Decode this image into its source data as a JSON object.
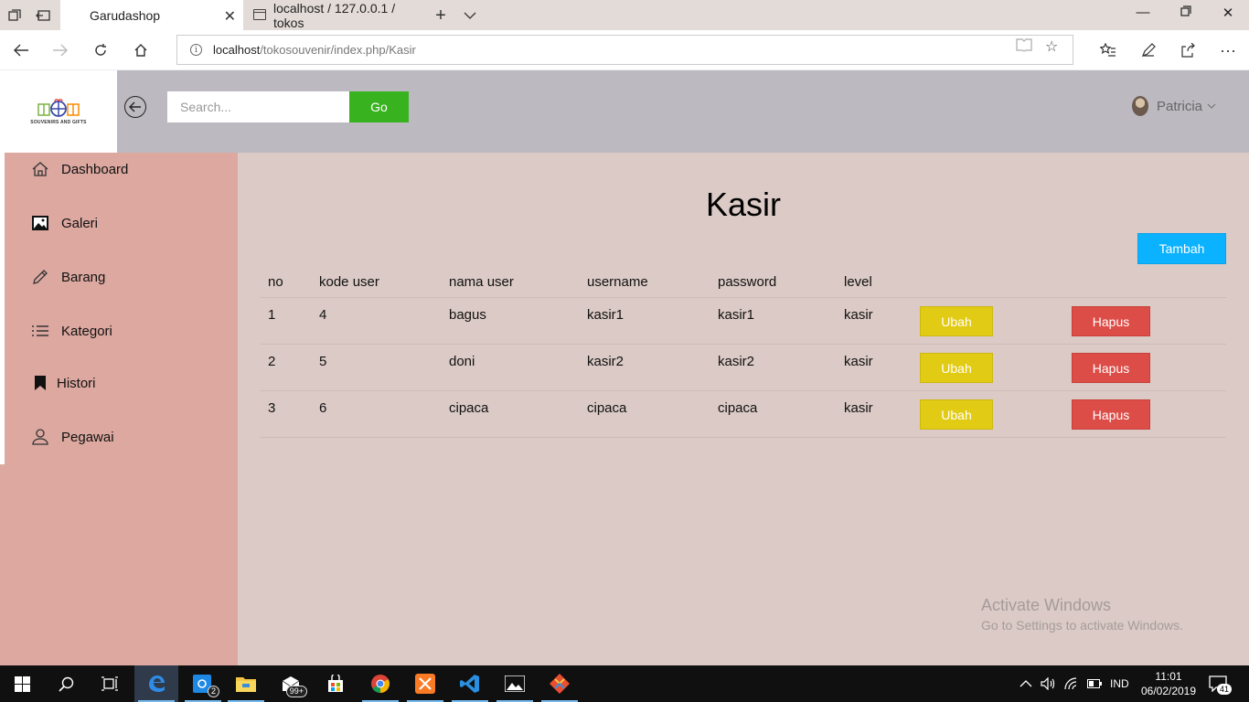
{
  "browser": {
    "tabs": [
      {
        "label": "Garudashop",
        "active": true
      },
      {
        "label": "localhost / 127.0.0.1 / tokos",
        "active": false
      }
    ],
    "address": {
      "host": "localhost",
      "path": "/tokosouvenir/index.php/Kasir"
    }
  },
  "header": {
    "logo_caption": "SOUVENIRS AND GIFTS",
    "search": {
      "placeholder": "Search...",
      "value": ""
    },
    "go_label": "Go",
    "user_name": "Patricia"
  },
  "sidebar": {
    "items": [
      {
        "label": "Dashboard",
        "icon": "home-icon"
      },
      {
        "label": "Galeri",
        "icon": "image-icon"
      },
      {
        "label": "Barang",
        "icon": "pencil-icon"
      },
      {
        "label": "Kategori",
        "icon": "list-icon"
      },
      {
        "label": "Histori",
        "icon": "bookmark-icon"
      },
      {
        "label": "Pegawai",
        "icon": "user-icon"
      }
    ]
  },
  "main": {
    "title": "Kasir",
    "add_label": "Tambah",
    "columns": [
      "no",
      "kode user",
      "nama user",
      "username",
      "password",
      "level"
    ],
    "rows": [
      {
        "no": "1",
        "kode_user": "4",
        "nama_user": "bagus",
        "username": "kasir1",
        "password": "kasir1",
        "level": "kasir"
      },
      {
        "no": "2",
        "kode_user": "5",
        "nama_user": "doni",
        "username": "kasir2",
        "password": "kasir2",
        "level": "kasir"
      },
      {
        "no": "3",
        "kode_user": "6",
        "nama_user": "cipaca",
        "username": "cipaca",
        "password": "cipaca",
        "level": "kasir"
      }
    ],
    "edit_label": "Ubah",
    "delete_label": "Hapus"
  },
  "watermark": {
    "line1": "Activate Windows",
    "line2": "Go to Settings to activate Windows."
  },
  "taskbar": {
    "mail_badge": "2",
    "store_badge": "99+",
    "language": "IND",
    "time": "11:01",
    "date": "06/02/2019",
    "notification_count": "41"
  },
  "colors": {
    "header_bg": "#bcb9c0",
    "sidebar_bg": "#dca8a0",
    "main_bg": "#dbcac5",
    "go_button": "#39b21f",
    "add_button": "#0bb2ff",
    "edit_button": "#e2cb14",
    "delete_button": "#dd4d48"
  }
}
